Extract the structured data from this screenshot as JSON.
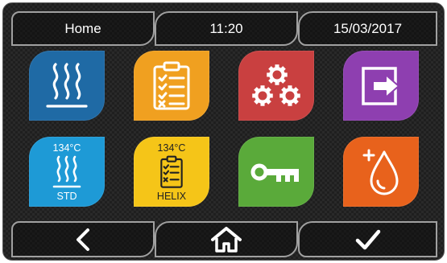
{
  "topbar": {
    "title": "Home",
    "time": "11:20",
    "date": "15/03/2017"
  },
  "tiles": {
    "heating": {
      "icon": "steam-heat-icon",
      "color": "#1f6aa5"
    },
    "checklist": {
      "icon": "clipboard-checklist-icon",
      "color": "#f0a020"
    },
    "settings": {
      "icon": "gears-icon",
      "color": "#c94040"
    },
    "exit": {
      "icon": "exit-arrow-icon",
      "color": "#8e3fb0"
    },
    "std": {
      "temp": "134°C",
      "label": "STD",
      "icon": "steam-heat-icon",
      "color": "#1e9ad6"
    },
    "helix": {
      "temp": "134°C",
      "label": "HELIX",
      "icon": "clipboard-checklist-icon",
      "color": "#f5c518"
    },
    "key": {
      "icon": "key-icon",
      "color": "#5aaa3a"
    },
    "water": {
      "icon": "water-drop-plus-icon",
      "color": "#e8621c"
    }
  },
  "bottombar": {
    "back": "chevron-left-icon",
    "home": "home-icon",
    "confirm": "checkmark-icon"
  }
}
